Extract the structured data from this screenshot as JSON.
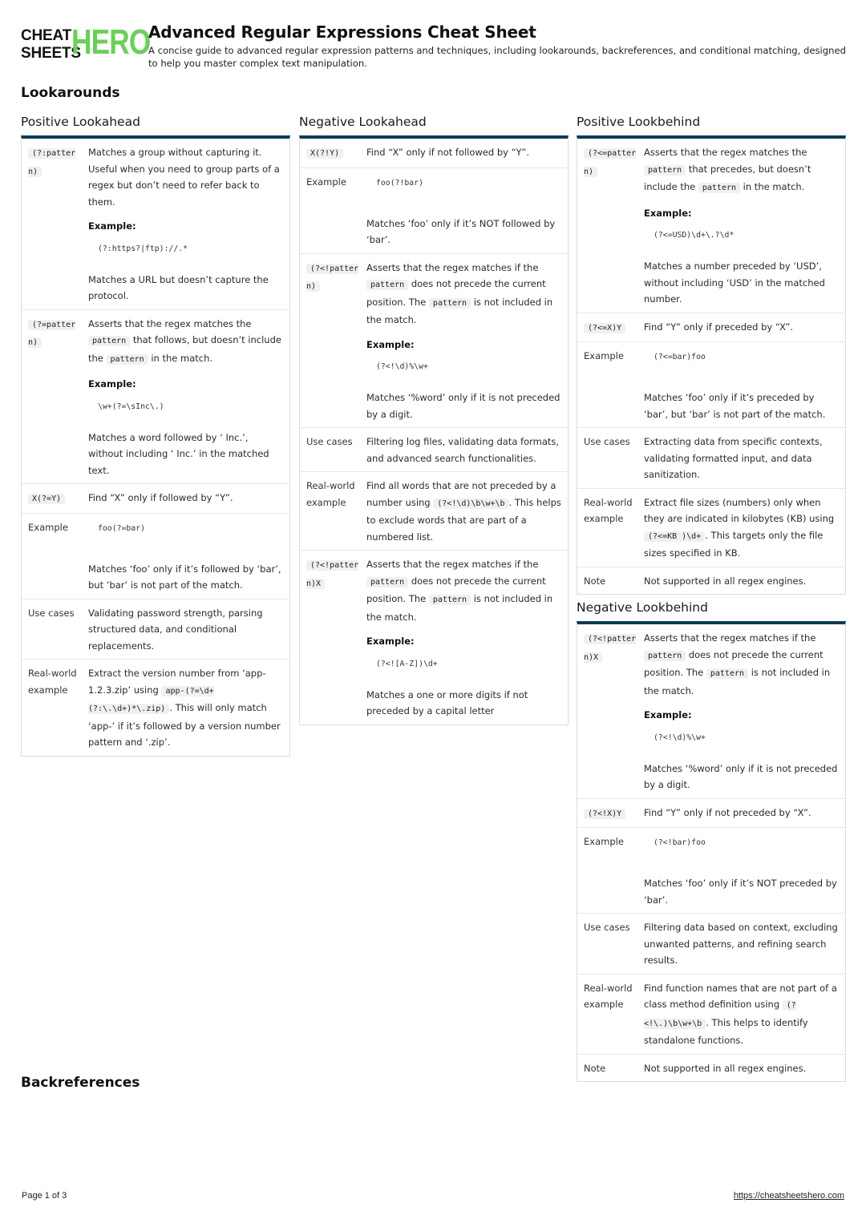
{
  "header": {
    "logo_top": "CHEAT",
    "logo_bottom": "SHEETS",
    "logo_accent": "HERO",
    "title": "Advanced Regular Expressions Cheat Sheet",
    "subtitle": "A concise guide to advanced regular expression patterns and techniques, including lookarounds, backreferences, and conditional matching, designed to help you master complex text manipulation."
  },
  "colors": {
    "accent_bar": "#0e3a55",
    "logo_green": "#6bcf5a"
  },
  "sections": {
    "lookarounds": "Lookarounds",
    "backreferences": "Backreferences"
  },
  "positive_lookahead": {
    "title": "Positive Lookahead",
    "r1": {
      "key": "(?:pattern)",
      "desc": "Matches a group without capturing it. Useful when you need to group parts of a regex but don’t need to refer back to them.",
      "ex_label": "Example:",
      "ex_code": "(?:https?|ftp)://.*",
      "ex_note": "Matches a URL but doesn’t capture the protocol."
    },
    "r2": {
      "key": "(?=pattern)",
      "d1": "Asserts that the regex matches the",
      "c1": "pattern",
      "d2": "that follows, but doesn’t include the",
      "c2": "pattern",
      "d3": "in the match.",
      "ex_label": "Example:",
      "ex_code": "\\w+(?=\\sInc\\.)",
      "ex_note": "Matches a word followed by ‘ Inc.’, without including ‘ Inc.’ in the matched text."
    },
    "r3": {
      "key": "X(?=Y)",
      "desc": "Find “X” only if followed by “Y”."
    },
    "r4": {
      "key": "Example",
      "ex_code": "foo(?=bar)",
      "ex_note": "Matches ‘foo’ only if it’s followed by ‘bar’, but ‘bar’ is not part of the match."
    },
    "r5": {
      "key": "Use cases",
      "desc": "Validating password strength, parsing structured data, and conditional replacements."
    },
    "r6": {
      "key": "Real-world example",
      "d1": "Extract the version number from ‘app-1.2.3.zip’ using",
      "c1": "app-(?=\\d+(?:\\.\\d+)*\\.zip)",
      "d2": ". This will only match ‘app-’ if it’s followed by a version number pattern and ‘.zip’."
    }
  },
  "negative_lookahead": {
    "title": "Negative Lookahead",
    "r1": {
      "key": "X(?!Y)",
      "desc": "Find “X” only if not followed by “Y”."
    },
    "r2": {
      "key": "Example",
      "ex_code": "foo(?!bar)",
      "ex_note": "Matches ‘foo’ only if it’s NOT followed by ‘bar’."
    },
    "r3": {
      "key": "(?<!pattern)",
      "d1": "Asserts that the regex matches if the",
      "c1": "pattern",
      "d2": "does not precede the current position. The",
      "c2": "pattern",
      "d3": "is not included in the match.",
      "ex_label": "Example:",
      "ex_code": "(?<!\\d)%\\w+",
      "ex_note": "Matches ‘%word’ only if it is not preceded by a digit."
    },
    "r4": {
      "key": "Use cases",
      "desc": "Filtering log files, validating data formats, and advanced search functionalities."
    },
    "r5": {
      "key": "Real-world example",
      "d1": "Find all words that are not preceded by a number using",
      "c1": "(?<!\\d)\\b\\w+\\b",
      "d2": ". This helps to exclude words that are part of a numbered list."
    },
    "r6": {
      "key": "(?<!pattern)X",
      "d1": "Asserts that the regex matches if the",
      "c1": "pattern",
      "d2": "does not precede the current position. The",
      "c2": "pattern",
      "d3": "is not included in the match.",
      "ex_label": "Example:",
      "ex_code": "(?<![A-Z])\\d+",
      "ex_note": "Matches a one or more digits if not preceded by a capital letter"
    }
  },
  "positive_lookbehind": {
    "title": "Positive Lookbehind",
    "r1": {
      "key": "(?<=pattern)",
      "d1": "Asserts that the regex matches the",
      "c1": "pattern",
      "d2": "that precedes, but doesn’t include the",
      "c2": "pattern",
      "d3": "in the match.",
      "ex_label": "Example:",
      "ex_code": "(?<=USD)\\d+\\.?\\d*",
      "ex_note": "Matches a number preceded by ‘USD’, without including ‘USD’ in the matched number."
    },
    "r2": {
      "key": "(?<=X)Y",
      "desc": "Find “Y” only if preceded by “X”."
    },
    "r3": {
      "key": "Example",
      "ex_code": "(?<=bar)foo",
      "ex_note": "Matches ‘foo’ only if it’s preceded by ‘bar’, but ‘bar’ is not part of the match."
    },
    "r4": {
      "key": "Use cases",
      "desc": "Extracting data from specific contexts, validating formatted input, and data sanitization."
    },
    "r5": {
      "key": "Real-world example",
      "d1": "Extract file sizes (numbers) only when they are indicated in kilobytes (KB) using",
      "c1": "(?<=KB )\\d+",
      "d2": ". This targets only the file sizes specified in KB."
    },
    "r6": {
      "key": "Note",
      "desc": "Not supported in all regex engines."
    }
  },
  "negative_lookbehind": {
    "title": "Negative Lookbehind",
    "r1": {
      "key": "(?<!pattern)X",
      "d1": "Asserts that the regex matches if the",
      "c1": "pattern",
      "d2": "does not precede the current position. The",
      "c2": "pattern",
      "d3": "is not included in the match.",
      "ex_label": "Example:",
      "ex_code": "(?<!\\d)%\\w+",
      "ex_note": "Matches ‘%word’ only if it is not preceded by a digit."
    },
    "r2": {
      "key": "(?<!X)Y",
      "desc": "Find “Y” only if not preceded by “X”."
    },
    "r3": {
      "key": "Example",
      "ex_code": "(?<!bar)foo",
      "ex_note": "Matches ‘foo’ only if it’s NOT preceded by ‘bar’."
    },
    "r4": {
      "key": "Use cases",
      "desc": "Filtering data based on context, excluding unwanted patterns, and refining search results."
    },
    "r5": {
      "key": "Real-world example",
      "d1": "Find function names that are not part of a class method definition using",
      "c1": "(?<!\\.)\\b\\w+\\b",
      "d2": ". This helps to identify standalone functions."
    },
    "r6": {
      "key": "Note",
      "desc": "Not supported in all regex engines."
    }
  },
  "footer": {
    "page": "Page 1 of 3",
    "url": "https://cheatsheetshero.com"
  }
}
